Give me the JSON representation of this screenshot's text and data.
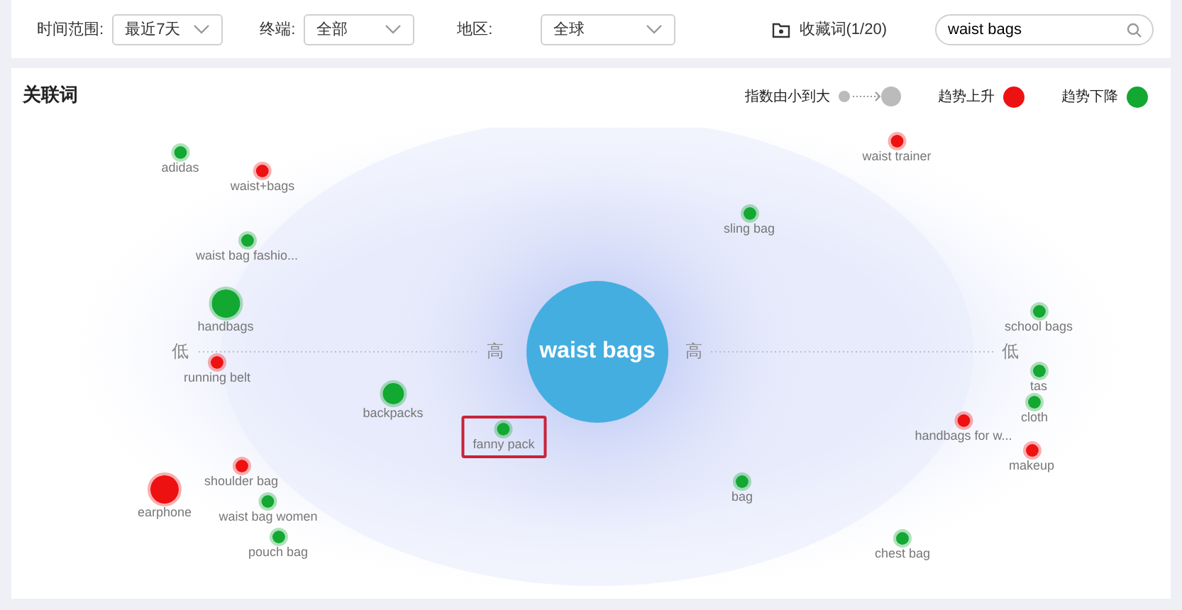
{
  "filters": [
    {
      "label": "时间范围:",
      "value": "最近7天"
    },
    {
      "label": "终端:",
      "value": "全部"
    },
    {
      "label": "地区:",
      "value": "全球"
    }
  ],
  "favorites": {
    "label": "收藏词(1/20)"
  },
  "search": {
    "value": "waist bags"
  },
  "panel": {
    "title": "关联词",
    "legend": {
      "size_label": "指数由小到大",
      "up_label": "趋势上升",
      "down_label": "趋势下降"
    },
    "center": {
      "label": "waist bags"
    },
    "axis_labels": [
      "低",
      "高",
      "高",
      "低"
    ],
    "nodes": [
      {
        "label": "adidas",
        "color": "#12a832",
        "kind": "small",
        "highlighted": false
      },
      {
        "label": "waist+bags",
        "color": "#ee1111",
        "kind": "small",
        "highlighted": false
      },
      {
        "label": "waist bag fashio...",
        "color": "#12a832",
        "kind": "small",
        "highlighted": false
      },
      {
        "label": "handbags",
        "color": "#12a832",
        "kind": "large",
        "highlighted": false
      },
      {
        "label": "running belt",
        "color": "#ee1111",
        "kind": "small",
        "highlighted": false
      },
      {
        "label": "backpacks",
        "color": "#12a832",
        "kind": "medium",
        "highlighted": false
      },
      {
        "label": "fanny pack",
        "color": "#12a832",
        "kind": "small",
        "highlighted": true
      },
      {
        "label": "shoulder bag",
        "color": "#ee1111",
        "kind": "small",
        "highlighted": false
      },
      {
        "label": "earphone",
        "color": "#ee1111",
        "kind": "large",
        "highlighted": false
      },
      {
        "label": "waist bag women",
        "color": "#12a832",
        "kind": "small",
        "highlighted": false
      },
      {
        "label": "pouch bag",
        "color": "#12a832",
        "kind": "small",
        "highlighted": false
      },
      {
        "label": "waist trainer",
        "color": "#ee1111",
        "kind": "small",
        "highlighted": false
      },
      {
        "label": "sling bag",
        "color": "#12a832",
        "kind": "small",
        "highlighted": false
      },
      {
        "label": "school bags",
        "color": "#12a832",
        "kind": "small",
        "highlighted": false
      },
      {
        "label": "tas",
        "color": "#12a832",
        "kind": "small",
        "highlighted": false
      },
      {
        "label": "cloth",
        "color": "#12a832",
        "kind": "small",
        "highlighted": false
      },
      {
        "label": "handbags for w...",
        "color": "#ee1111",
        "kind": "small",
        "highlighted": false
      },
      {
        "label": "makeup",
        "color": "#ee1111",
        "kind": "small",
        "highlighted": false
      },
      {
        "label": "bag",
        "color": "#12a832",
        "kind": "small",
        "highlighted": false
      },
      {
        "label": "chest bag",
        "color": "#12a832",
        "kind": "small",
        "highlighted": false
      }
    ]
  }
}
